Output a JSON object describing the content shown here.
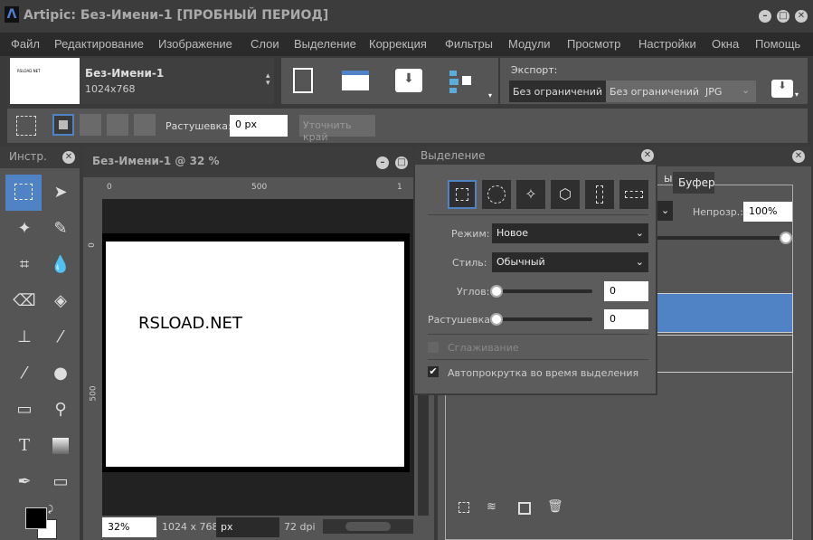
{
  "window": {
    "title": "Artipic: Без-Имени-1 [ПРОБНЫЙ ПЕРИОД]",
    "logo": "Λ"
  },
  "menu": [
    "Файл",
    "Редактирование",
    "Изображение",
    "Слои",
    "Выделение",
    "Коррекция",
    "Фильтры",
    "Модули",
    "Просмотр",
    "Настройки",
    "Окна",
    "Помощь"
  ],
  "document": {
    "name": "Без-Имени-1",
    "size": "1024x768",
    "thumb_text": "RSLOAD.NET",
    "canvas_text": "RSLOAD.NET",
    "window_title": "Без-Имени-1 @ 32 %"
  },
  "export": {
    "label": "Экспорт:",
    "width": "Без ограничений",
    "height": "Без ограничений",
    "format": "JPG"
  },
  "options": {
    "feather_label": "Растушевка:",
    "feather_value": "0 px",
    "refine_edge": "Уточнить край"
  },
  "tools_panel": {
    "title": "Инстр."
  },
  "ruler": {
    "h": [
      "0",
      "500",
      "1"
    ],
    "v": [
      "0",
      "500"
    ]
  },
  "status": {
    "zoom": "32%",
    "dimensions": "1024 x 768",
    "unit": "px",
    "dpi": "72 dpi"
  },
  "layers_panel": {
    "tab_partial": "ы",
    "tab_buffer": "Буфер",
    "opacity_label": "Непрозр.:",
    "opacity": "100%",
    "opacity_fraction": 1.0
  },
  "selection_dialog": {
    "title": "Выделение",
    "mode_label": "Режим:",
    "mode": "Новое",
    "style_label": "Стиль:",
    "style": "Обычный",
    "corners_label": "Углов:",
    "corners": "0",
    "feather_label": "Растушевка:",
    "feather": "0",
    "antialias": "Сглаживание",
    "antialias_checked": false,
    "autoscroll": "Автопрокрутка во время выделения",
    "autoscroll_checked": true
  },
  "colors": {
    "accent": "#4f83c6",
    "foreground": "#000000",
    "background": "#ffffff"
  }
}
